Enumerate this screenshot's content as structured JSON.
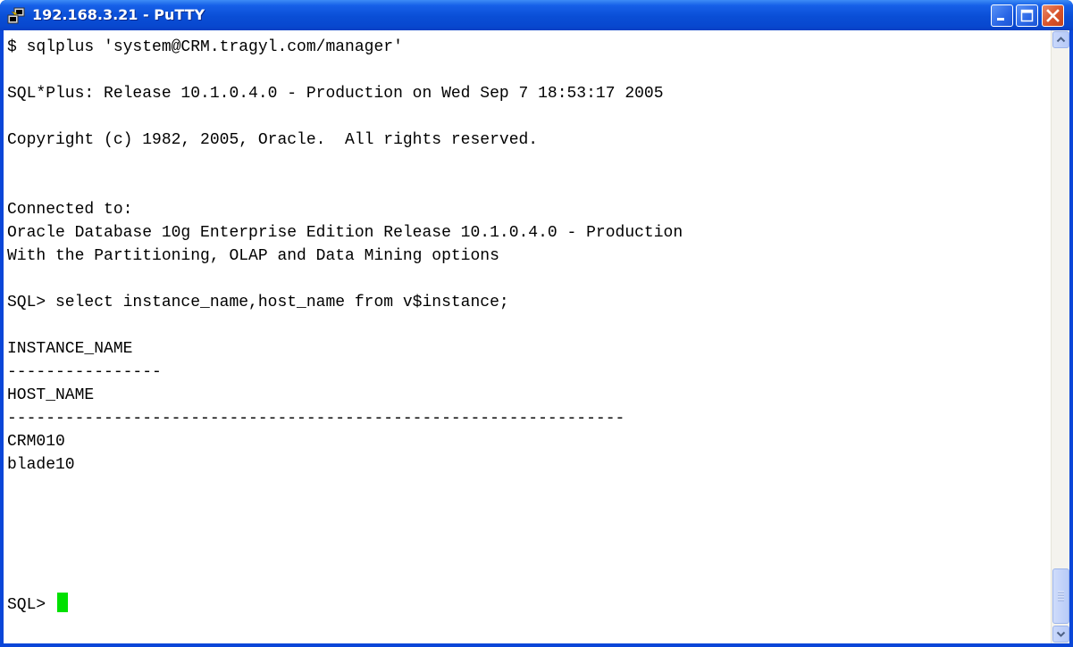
{
  "window": {
    "title": "192.168.3.21 - PuTTY",
    "app_icon": "putty-icon",
    "controls": [
      "minimize-icon",
      "maximize-icon",
      "close-icon"
    ]
  },
  "terminal": {
    "lines": [
      "$ sqlplus 'system@CRM.tragyl.com/manager'",
      "",
      "SQL*Plus: Release 10.1.0.4.0 - Production on Wed Sep 7 18:53:17 2005",
      "",
      "Copyright (c) 1982, 2005, Oracle.  All rights reserved.",
      "",
      "",
      "Connected to:",
      "Oracle Database 10g Enterprise Edition Release 10.1.0.4.0 - Production",
      "With the Partitioning, OLAP and Data Mining options",
      "",
      "SQL> select instance_name,host_name from v$instance;",
      "",
      "INSTANCE_NAME",
      "----------------",
      "HOST_NAME",
      "----------------------------------------------------------------",
      "CRM010",
      "blade10",
      "",
      "",
      "SQL> "
    ],
    "cursor_color": "#00e000"
  },
  "colors": {
    "titlebar": "#0a4ed6",
    "close_button": "#d9532b",
    "terminal_background": "#ffffff",
    "terminal_text": "#000000"
  }
}
